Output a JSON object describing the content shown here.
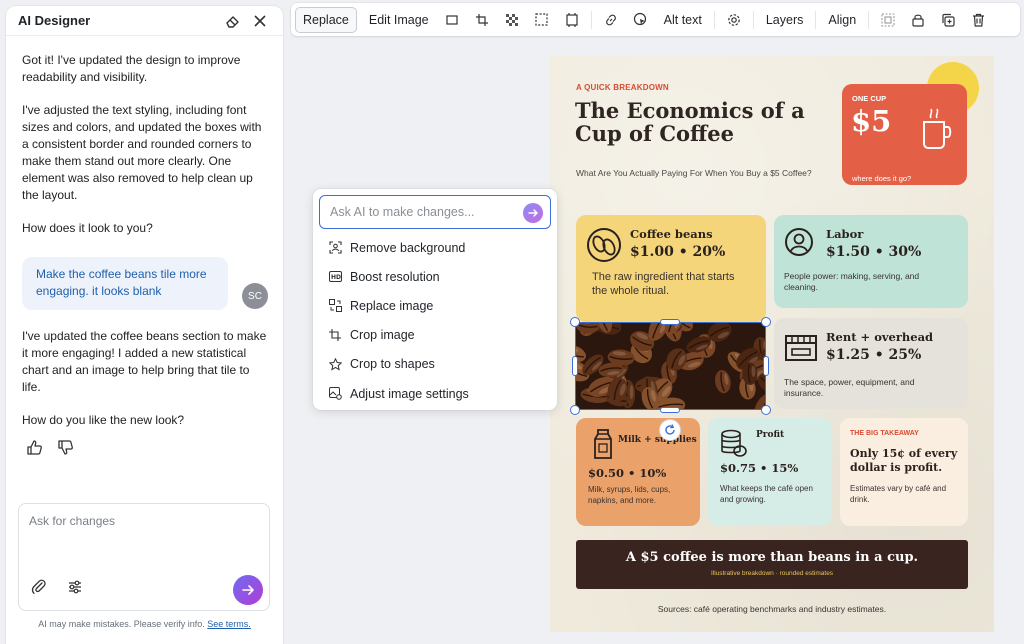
{
  "sidebar": {
    "title": "AI Designer",
    "messages": {
      "ai_1": "Got it! I've updated the design to improve readability and visibility.",
      "ai_2": "I've adjusted the text styling, including font sizes and colors, and updated the boxes with a consistent border and rounded corners to make them stand out more clearly. One element was also removed to help clean up the layout.",
      "ai_3": "How does it look to you?",
      "user_1": "Make the coffee beans tile more engaging. it looks blank",
      "user_initials": "SC",
      "ai_4": "I've updated the coffee beans section to make it more engaging! I added a new statistical chart and an image to help bring that tile to life.",
      "ai_5": "How do you like the new look?"
    },
    "composer_placeholder": "Ask for changes",
    "disclaimer": "AI may make mistakes. Please verify info.",
    "disclaimer_link": "See terms."
  },
  "toolbar": {
    "replace": "Replace",
    "edit_image": "Edit Image",
    "alt_text": "Alt text",
    "layers": "Layers",
    "align": "Align"
  },
  "ai_popup": {
    "placeholder": "Ask AI to make changes...",
    "items": [
      "Remove background",
      "Boost resolution",
      "Replace image",
      "Crop image",
      "Crop to shapes",
      "Adjust image settings"
    ]
  },
  "poster": {
    "kicker": "A QUICK BREAKDOWN",
    "headline": "The Economics of a Cup of Coffee",
    "subhead": "What Are You Actually Paying For When You Buy a $5 Coffee?",
    "onecup": {
      "label": "ONE CUP",
      "price": "$5",
      "question": "where does it go?"
    },
    "beans": {
      "title": "Coffee beans",
      "value": "$1.00 • 20%",
      "desc": "The raw ingredient that starts the whole ritual."
    },
    "labor": {
      "title": "Labor",
      "value": "$1.50 • 30%",
      "desc": "People power: making, serving, and cleaning."
    },
    "rent": {
      "title": "Rent + overhead",
      "value": "$1.25 • 25%",
      "desc": "The space, power, equipment, and insurance."
    },
    "milk": {
      "title": "Milk + supplies",
      "value": "$0.50 • 10%",
      "desc": "Milk, syrups, lids, cups, napkins, and more."
    },
    "profit": {
      "title": "Profit",
      "value": "$0.75 • 15%",
      "desc": "What keeps the café open and growing."
    },
    "takeaway": {
      "kicker": "THE BIG TAKEAWAY",
      "title": "Only 15¢ of every dollar is profit.",
      "desc": "Estimates vary by café and drink."
    },
    "banner": {
      "main": "A $5 coffee is more than beans in a cup.",
      "sub": "Illustrative breakdown · rounded estimates"
    },
    "sources": "Sources: café operating benchmarks and industry estimates."
  },
  "colors": {
    "accent_blue": "#3b6fd4",
    "poster_bg": "#efeadc",
    "onecup_card": "#e35f45",
    "beans_card": "#f4d57a",
    "labor_card": "#bfe3d7",
    "rent_card": "#e5e2db",
    "milk_card": "#eaa16a",
    "profit_card": "#d6ece7",
    "takeaway_card": "#faeee0",
    "banner": "#3a2420"
  }
}
